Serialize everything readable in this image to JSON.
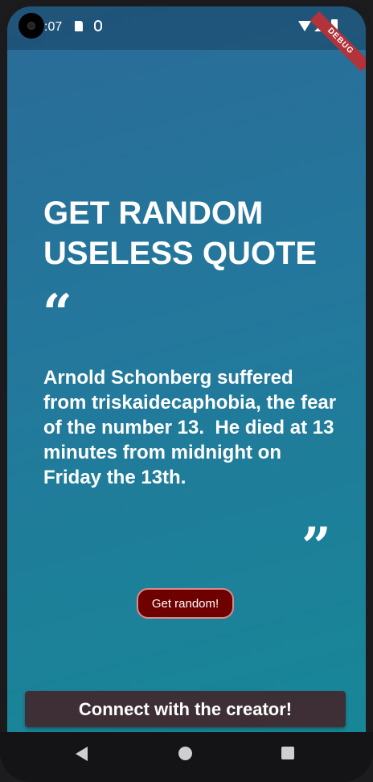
{
  "status_bar": {
    "time": ":07",
    "icons": [
      "camera-cutout",
      "sd-card-icon",
      "debug-bug-icon",
      "wifi-icon",
      "cell-signal-icon",
      "battery-icon"
    ]
  },
  "debug_banner": "DEBUG",
  "main": {
    "title": "GET RANDOM USELESS QUOTE",
    "open_quote_mark": "“",
    "quote": "Arnold Schonberg suffered from triskaidecaphobia, the fear of the number 13.  He died at 13 minutes from midnight on Friday the 13th.",
    "close_quote_mark": "”",
    "random_button_label": "Get random!",
    "connect_button_label": "Connect with the creator!"
  },
  "nav_bar": {
    "icons": [
      "back-icon",
      "home-icon",
      "recents-icon"
    ]
  },
  "colors": {
    "gradient_top": "#2a6b98",
    "gradient_bottom": "#178797",
    "random_button_bg": "#6e0000",
    "connect_button_bg": "#3e2f36",
    "debug_ribbon": "#b3333a"
  }
}
